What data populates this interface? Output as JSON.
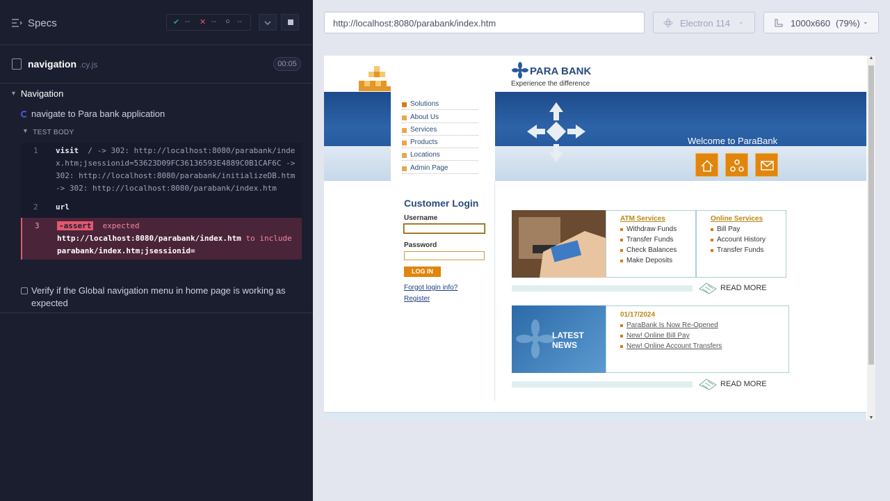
{
  "sidebar": {
    "title": "Specs",
    "stats": {
      "passed": "--",
      "failed": "--",
      "pending": "--"
    },
    "file": {
      "name": "navigation",
      "ext": ".cy.js",
      "duration": "00:05"
    },
    "suite": "Navigation",
    "tests": [
      {
        "title": "navigate to Para bank application",
        "state": "running"
      },
      {
        "title": "Verify if the Global navigation menu in home page is working as expected",
        "state": "pending"
      }
    ],
    "test_body_label": "TEST BODY",
    "commands": [
      {
        "num": "1",
        "name": "visit",
        "message": "/ -> 302: http://localhost:8080/parabank/index.htm;jsessionid=53623D09FC36136593E4889C0B1CAF6C -> 302: http://localhost:8080/parabank/initializeDB.htm -> 302: http://localhost:8080/parabank/index.htm"
      },
      {
        "num": "2",
        "name": "url",
        "message": ""
      },
      {
        "num": "3",
        "name": "-assert",
        "expected_word": "expected",
        "actual": "http://localhost:8080/parabank/index.htm",
        "to_include": "to include",
        "expected_value": "parabank/index.htm;jsessionid="
      }
    ]
  },
  "browser": {
    "url": "http://localhost:8080/parabank/index.htm",
    "engine": "Electron 114",
    "viewport": "1000x660",
    "zoom": "(79%)"
  },
  "parabank": {
    "logo": "PARA BANK",
    "tagline": "Experience the difference",
    "menu": [
      "Solutions",
      "About Us",
      "Services",
      "Products",
      "Locations",
      "Admin Page"
    ],
    "welcome": "Welcome to ParaBank",
    "login": {
      "title": "Customer Login",
      "username_label": "Username",
      "password_label": "Password",
      "button": "LOG IN",
      "forgot": "Forgot login info?",
      "register": "Register"
    },
    "atm": {
      "title": "ATM Services",
      "items": [
        "Withdraw Funds",
        "Transfer Funds",
        "Check Balances",
        "Make Deposits"
      ]
    },
    "online": {
      "title": "Online Services",
      "items": [
        "Bill Pay",
        "Account History",
        "Transfer Funds"
      ]
    },
    "read_more": "READ MORE",
    "news": {
      "banner_line1": "LATEST",
      "banner_line2": "NEWS",
      "date": "01/17/2024",
      "items": [
        "ParaBank Is Now Re-Opened",
        "New! Online Bill Pay",
        "New! Online Account Transfers"
      ]
    }
  }
}
